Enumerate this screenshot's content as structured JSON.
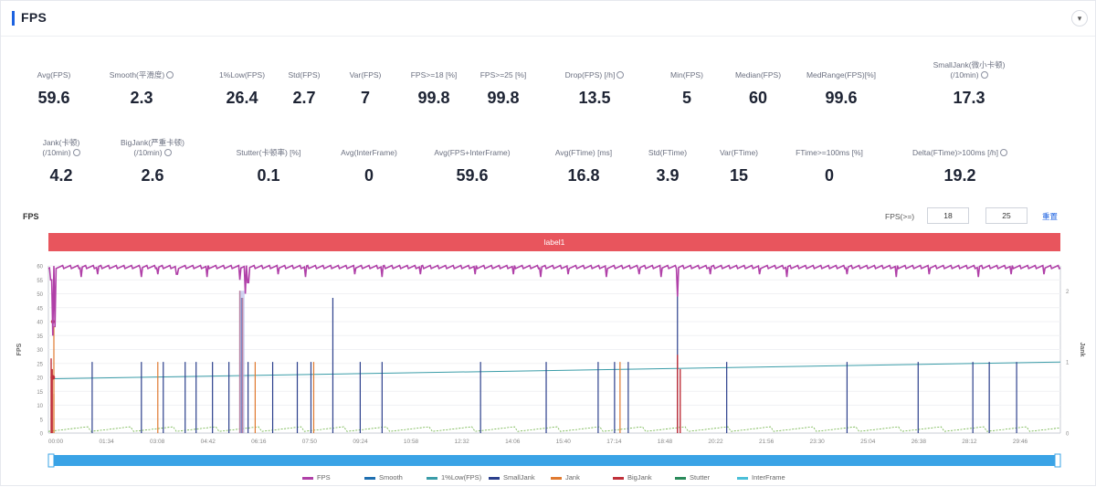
{
  "header": {
    "title": "FPS",
    "toggle_icon": "chevron-down-icon"
  },
  "metrics_row1": [
    {
      "label": "Avg(FPS)",
      "value": "59.6",
      "info": false
    },
    {
      "label": "Smooth(平滑度)",
      "value": "2.3",
      "info": true
    },
    {
      "label": "1%Low(FPS)",
      "value": "26.4",
      "info": false
    },
    {
      "label": "Std(FPS)",
      "value": "2.7",
      "info": false
    },
    {
      "label": "Var(FPS)",
      "value": "7",
      "info": false
    },
    {
      "label": "FPS>=18 [%]",
      "value": "99.8",
      "info": false
    },
    {
      "label": "FPS>=25 [%]",
      "value": "99.8",
      "info": false
    },
    {
      "label": "Drop(FPS) [/h]",
      "value": "13.5",
      "info": true
    },
    {
      "label": "Min(FPS)",
      "value": "5",
      "info": false
    },
    {
      "label": "Median(FPS)",
      "value": "60",
      "info": false
    },
    {
      "label": "MedRange(FPS)[%]",
      "value": "99.6",
      "info": false
    },
    {
      "label": "SmallJank(微小卡顿)",
      "label2": "(/10min)",
      "value": "17.3",
      "info": true
    }
  ],
  "metrics_row2": [
    {
      "label": "Jank(卡顿)",
      "label2": "(/10min)",
      "value": "4.2",
      "info": true
    },
    {
      "label": "BigJank(严重卡顿)",
      "label2": "(/10min)",
      "value": "2.6",
      "info": true
    },
    {
      "label": "Stutter(卡顿率) [%]",
      "value": "0.1",
      "info": false
    },
    {
      "label": "Avg(InterFrame)",
      "value": "0",
      "info": false
    },
    {
      "label": "Avg(FPS+InterFrame)",
      "value": "59.6",
      "info": false
    },
    {
      "label": "Avg(FTime) [ms]",
      "value": "16.8",
      "info": false
    },
    {
      "label": "Std(FTime)",
      "value": "3.9",
      "info": false
    },
    {
      "label": "Var(FTime)",
      "value": "15",
      "info": false
    },
    {
      "label": "FTime>=100ms [%]",
      "value": "0",
      "info": false
    },
    {
      "label": "Delta(FTime)>100ms [/h]",
      "value": "19.2",
      "info": true
    }
  ],
  "chart_section": {
    "title": "FPS",
    "threshold_label": "FPS(>=)",
    "threshold_1": "18",
    "threshold_2": "25",
    "reset_label": "重置",
    "label_bar": "label1"
  },
  "chart_data": {
    "type": "line",
    "xlabel": "",
    "ylabel": "FPS",
    "y2label": "Jank",
    "x_ticks": [
      "00:00",
      "01:34",
      "03:08",
      "04:42",
      "06:16",
      "07:50",
      "09:24",
      "10:58",
      "12:32",
      "14:06",
      "15:40",
      "17:14",
      "18:48",
      "20:22",
      "21:56",
      "23:30",
      "25:04",
      "26:38",
      "28:12",
      "29:46"
    ],
    "y_ticks": [
      0,
      5,
      10,
      15,
      20,
      25,
      30,
      35,
      40,
      45,
      50,
      55,
      60
    ],
    "ylim": [
      0,
      60
    ],
    "y2_ticks": [
      0,
      1,
      2
    ],
    "y2lim": [
      0,
      2.35
    ],
    "xlim": [
      0,
      1850
    ],
    "colors": {
      "fps": "#b040a8",
      "smooth": "#1f6fb0",
      "low1": "#3a9ca8",
      "smalljank": "#2b3f8c",
      "jank": "#e07a30",
      "bigjank": "#c0303a",
      "stutter": "#2a8a5a",
      "interframe": "#4bbfd8",
      "low_fps_trace": "#6ab040"
    },
    "fps_baseline": 59.6,
    "fps_dips": [
      [
        5,
        55
      ],
      [
        8,
        35
      ],
      [
        12,
        38
      ],
      [
        60,
        56
      ],
      [
        90,
        57
      ],
      [
        170,
        56
      ],
      [
        200,
        57
      ],
      [
        235,
        57
      ],
      [
        290,
        56
      ],
      [
        350,
        55
      ],
      [
        360,
        50
      ],
      [
        365,
        54
      ],
      [
        420,
        57
      ],
      [
        470,
        56
      ],
      [
        560,
        57
      ],
      [
        610,
        56
      ],
      [
        680,
        57
      ],
      [
        780,
        57
      ],
      [
        850,
        57
      ],
      [
        900,
        56
      ],
      [
        950,
        57
      ],
      [
        1020,
        56
      ],
      [
        1080,
        57
      ],
      [
        1120,
        56
      ],
      [
        1150,
        49
      ],
      [
        1210,
        57
      ],
      [
        1300,
        57
      ],
      [
        1350,
        56
      ],
      [
        1460,
        57
      ],
      [
        1550,
        56
      ],
      [
        1610,
        57
      ],
      [
        1700,
        56
      ],
      [
        1760,
        57
      ],
      [
        1820,
        57
      ]
    ],
    "low1_start": 19.5,
    "low1_end": 25.5,
    "smalljank_spikes": [
      [
        80,
        1
      ],
      [
        170,
        1
      ],
      [
        210,
        1
      ],
      [
        250,
        1
      ],
      [
        270,
        1
      ],
      [
        300,
        1
      ],
      [
        330,
        1
      ],
      [
        350,
        1
      ],
      [
        353,
        1.9
      ],
      [
        365,
        1
      ],
      [
        410,
        1
      ],
      [
        455,
        1
      ],
      [
        480,
        1
      ],
      [
        520,
        1.9
      ],
      [
        570,
        1
      ],
      [
        610,
        1
      ],
      [
        790,
        1
      ],
      [
        910,
        1
      ],
      [
        1005,
        1
      ],
      [
        1035,
        1
      ],
      [
        1060,
        1
      ],
      [
        1150,
        2
      ],
      [
        1240,
        1
      ],
      [
        1460,
        1
      ],
      [
        1590,
        1
      ],
      [
        1690,
        1
      ],
      [
        1720,
        1
      ],
      [
        1770,
        1
      ]
    ],
    "bigjank_spikes": [
      [
        5,
        1.05
      ],
      [
        7,
        0.9
      ],
      [
        350,
        2.0
      ],
      [
        355,
        1.9
      ],
      [
        1150,
        1.1
      ],
      [
        1155,
        0.9
      ]
    ],
    "jank_spikes": [
      [
        10,
        1.5
      ],
      [
        10,
        0.55
      ],
      [
        200,
        1.0
      ],
      [
        378,
        1.0
      ],
      [
        485,
        1.0
      ],
      [
        1045,
        1.0
      ]
    ],
    "legend": [
      {
        "name": "FPS",
        "color": "#b040a8"
      },
      {
        "name": "Smooth",
        "color": "#1f6fb0"
      },
      {
        "name": "1%Low(FPS)",
        "color": "#3a9ca8"
      },
      {
        "name": "SmallJank",
        "color": "#2b3f8c"
      },
      {
        "name": "Jank",
        "color": "#e07a30"
      },
      {
        "name": "BigJank",
        "color": "#c0303a"
      },
      {
        "name": "Stutter",
        "color": "#2a8a5a"
      },
      {
        "name": "InterFrame",
        "color": "#4bbfd8"
      }
    ]
  }
}
